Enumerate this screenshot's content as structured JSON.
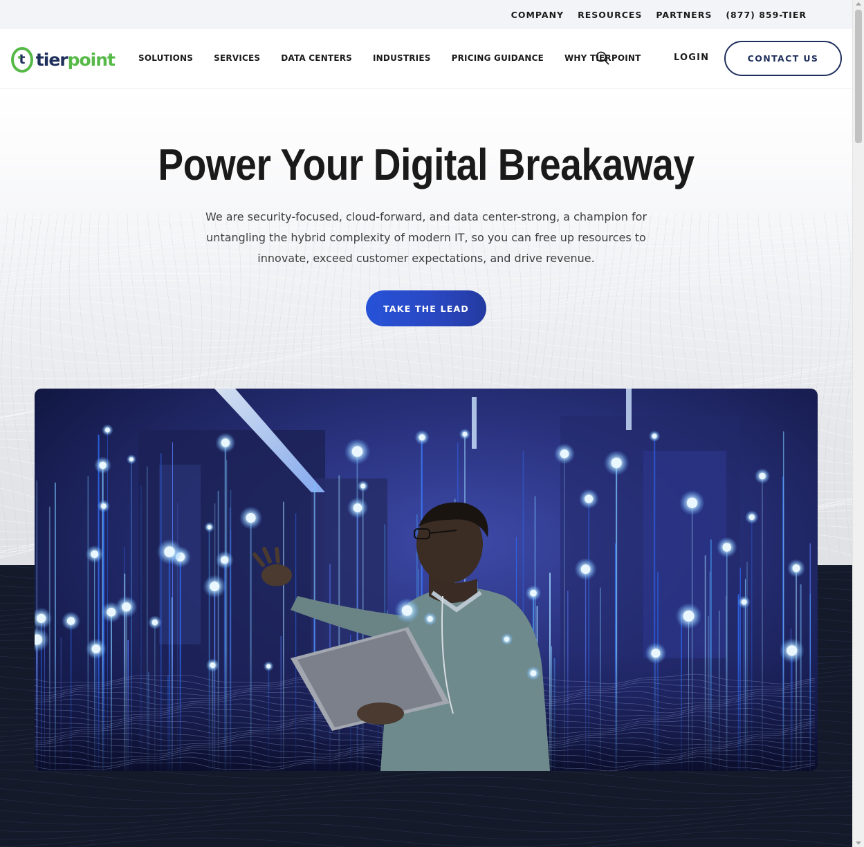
{
  "utility_nav": {
    "company": "COMPANY",
    "resources": "RESOURCES",
    "partners": "PARTNERS",
    "phone": "(877) 859-TIER"
  },
  "brand": {
    "logo_mark": "t",
    "name_part1": "tier",
    "name_part2": "point",
    "primary_color": "#1f2f5c",
    "accent_color": "#56b948"
  },
  "main_nav": {
    "items": [
      {
        "label": "SOLUTIONS"
      },
      {
        "label": "SERVICES"
      },
      {
        "label": "DATA CENTERS"
      },
      {
        "label": "INDUSTRIES"
      },
      {
        "label": "PRICING GUIDANCE"
      },
      {
        "label": "WHY TIERPOINT"
      }
    ],
    "search_icon": "search-icon",
    "login": "LOGIN",
    "contact": "CONTACT US"
  },
  "hero": {
    "title": "Power Your Digital Breakaway",
    "subtitle": "We are security-focused, cloud-forward, and data center-strong, a champion for untangling the hybrid complexity of modern IT, so you can free up resources to innovate, exceed customer expectations, and drive revenue.",
    "cta": "TAKE THE LEAD",
    "cta_color": "#2652d8",
    "image_alt": "Technician holding a laptop in a glowing blue data center"
  },
  "dark_section_color": "#141a2a"
}
